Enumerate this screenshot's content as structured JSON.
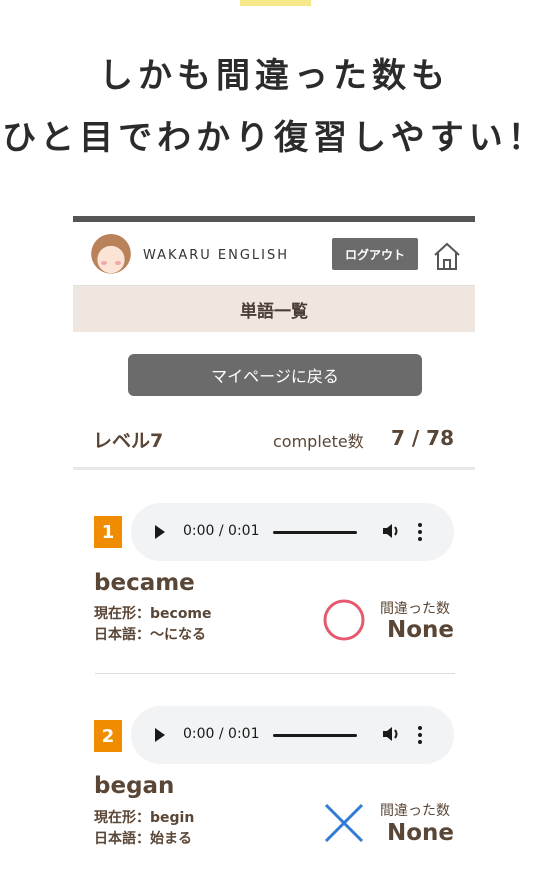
{
  "headline": {
    "line1": "しかも間違った数も",
    "line2": "ひと目でわかり復習しやすい！"
  },
  "app": {
    "brand": "WAKARU ENGLISH",
    "logout_label": "ログアウト",
    "home_icon": "home-icon",
    "section_title": "単語一覧",
    "mypage_button": "マイページに戻る"
  },
  "level": {
    "label": "レベル7",
    "complete_label": "complete数",
    "complete_value": "7 / 78",
    "complete_count": 7,
    "total_count": 78
  },
  "audio": {
    "time": "0:00 / 0:01"
  },
  "words": [
    {
      "number": "1",
      "word": "became",
      "present": "現在形：become",
      "japanese": "日本語：〜になる",
      "mistake_label": "間違った数",
      "mistake_value": "None",
      "result": "correct-circle",
      "result_color": "#e45a6e"
    },
    {
      "number": "2",
      "word": "began",
      "present": "現在形：begin",
      "japanese": "日本語：始まる",
      "mistake_label": "間違った数",
      "mistake_value": "None",
      "result": "incorrect-cross",
      "result_color": "#2f7bd4"
    }
  ],
  "colors": {
    "accent_orange": "#f08c00",
    "section_bg": "#efe6df",
    "button_gray": "#6b6b6b",
    "text_brown": "#5a4636",
    "highlight_yellow": "#f7e98a"
  }
}
